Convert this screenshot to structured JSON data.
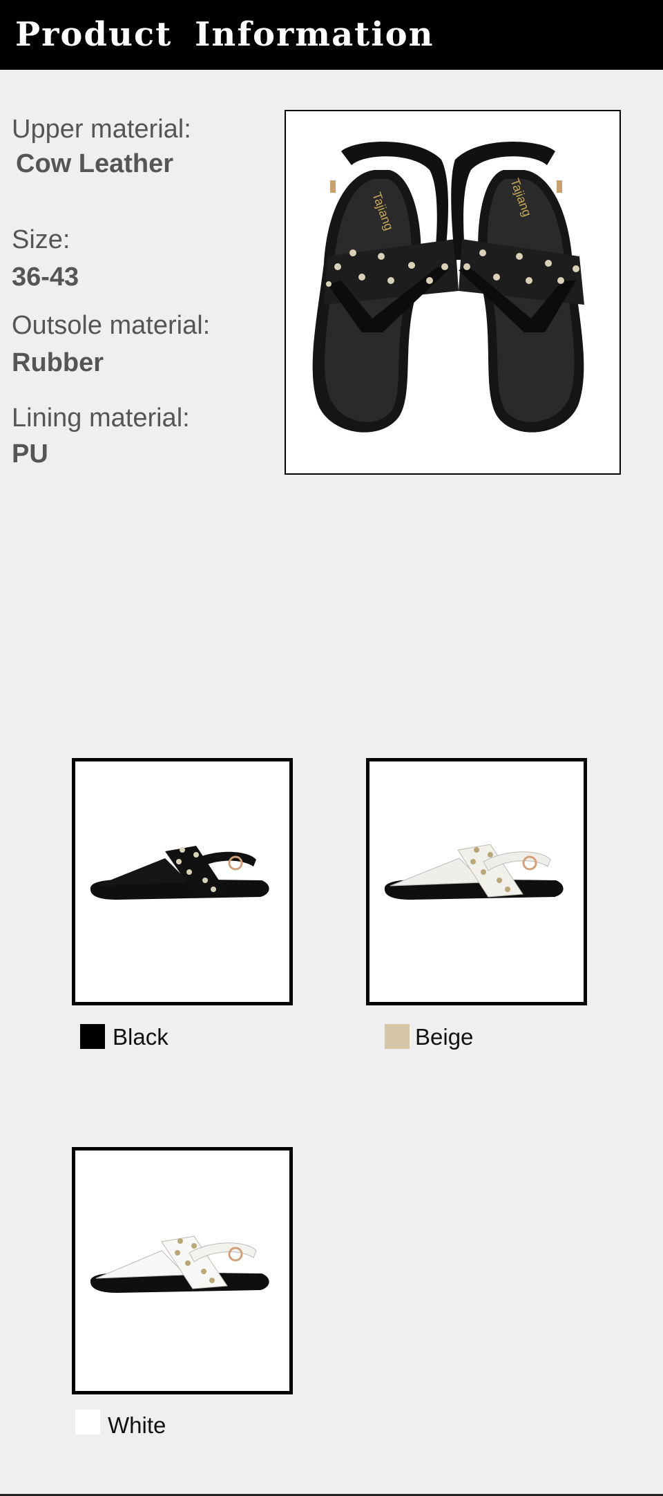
{
  "header": {
    "title": "Product Information"
  },
  "specs": [
    {
      "label": "Upper material:",
      "value": "Cow Leather"
    },
    {
      "label": "Size:",
      "value": "36-43"
    },
    {
      "label": "Outsole material:",
      "value": "Rubber"
    },
    {
      "label": "Lining material:",
      "value": "PU"
    }
  ],
  "main_image": {
    "brand_logo": "Tajiang",
    "icon": "sandal-pair-photo"
  },
  "colors": [
    {
      "name": "Black",
      "hex": "#000000",
      "strap": "#111111"
    },
    {
      "name": "Beige",
      "hex": "#d8c7a6",
      "strap": "#f2f0ea"
    },
    {
      "name": "White",
      "hex": "#ffffff",
      "strap": "#f7f7f5"
    }
  ]
}
